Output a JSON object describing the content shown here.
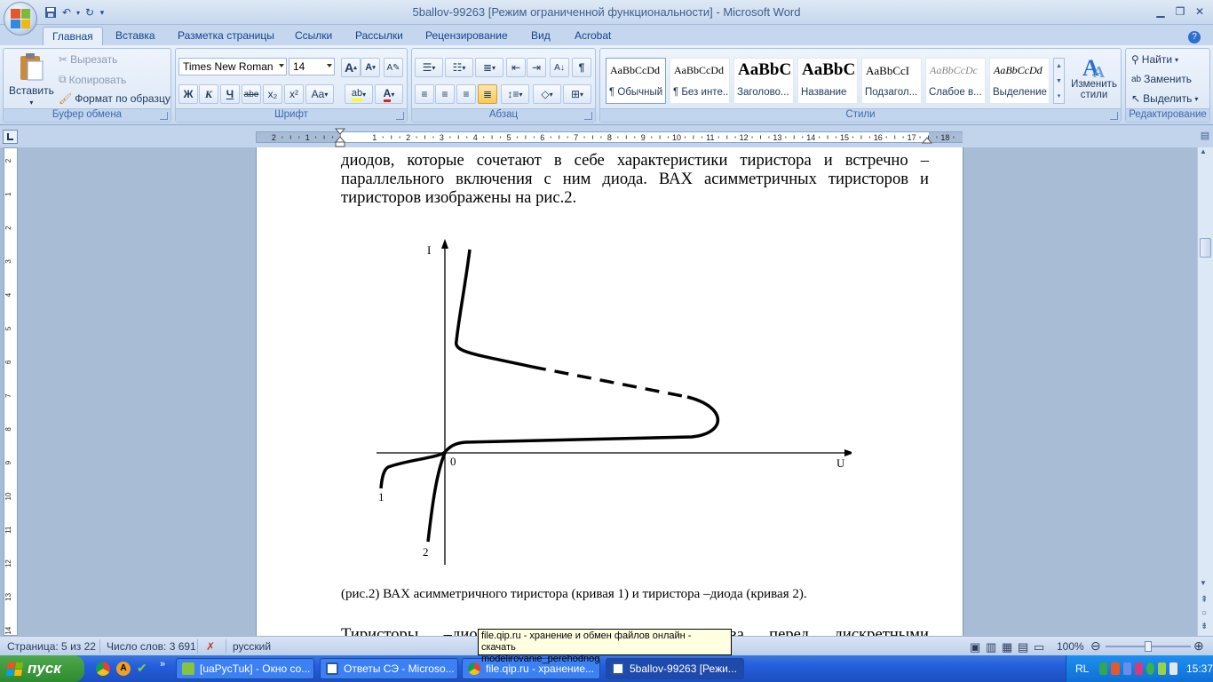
{
  "window": {
    "title": "5ballov-99263 [Режим ограниченной функциональности] - Microsoft Word"
  },
  "tabs": [
    "Главная",
    "Вставка",
    "Разметка страницы",
    "Ссылки",
    "Рассылки",
    "Рецензирование",
    "Вид",
    "Acrobat"
  ],
  "ribbon": {
    "clipboard": {
      "paste": "Вставить",
      "cut": "Вырезать",
      "copy": "Копировать",
      "format_painter": "Формат по образцу",
      "label": "Буфер обмена"
    },
    "font": {
      "font_name": "Times New Roman",
      "font_size": "14",
      "label": "Шрифт",
      "bold": "Ж",
      "italic": "К",
      "underline": "Ч",
      "strike": "abe",
      "subscript": "x₂",
      "superscript": "x²",
      "change_case": "Aa",
      "grow": "A",
      "shrink": "A",
      "highlight": "ab",
      "font_color": "A"
    },
    "paragraph": {
      "label": "Абзац",
      "pilcrow": "¶"
    },
    "styles": {
      "label": "Стили",
      "items": [
        {
          "sample": "AaBbCcDd",
          "name": "¶ Обычный"
        },
        {
          "sample": "AaBbCcDd",
          "name": "¶ Без инте..."
        },
        {
          "sample": "AaBbC",
          "name": "Заголово..."
        },
        {
          "sample": "AaBbC",
          "name": "Название"
        },
        {
          "sample": "AaBbCcI",
          "name": "Подзагол..."
        },
        {
          "sample": "AaBbCcDc",
          "name": "Слабое в..."
        },
        {
          "sample": "AaBbCcDd",
          "name": "Выделение"
        }
      ],
      "change_styles": "Изменить стили"
    },
    "editing": {
      "label": "Редактирование",
      "find": "Найти",
      "replace": "Заменить",
      "select": "Выделить"
    }
  },
  "ruler": {
    "labels": [
      "2",
      "1",
      "1",
      "2",
      "3",
      "4",
      "5",
      "6",
      "7",
      "8",
      "9",
      "10",
      "11",
      "12",
      "13",
      "14",
      "15",
      "16",
      "17",
      "18"
    ],
    "vlabels": [
      "2",
      "1",
      "2",
      "3",
      "4",
      "5",
      "6",
      "7",
      "8",
      "9",
      "10",
      "11",
      "12",
      "13",
      "14",
      "15",
      "16"
    ]
  },
  "document": {
    "line1": "диодов, которые сочетают в себе характеристики тиристора и встречно –",
    "line2": "параллельного включения с ним диода. ВАХ асимметричных тиристоров и",
    "line3": "тиристоров изображены на рис.2.",
    "figure": {
      "label_i": "I",
      "label_u": "U",
      "label_0": "0",
      "label_1": "1",
      "label_2": "2"
    },
    "caption": "(рис.2) ВАХ асимметричного тиристора (кривая 1) и тиристора –диода (кривая 2).",
    "next_line": "Тиристоры –диоды имеют ряд преимущества перед дискретными"
  },
  "statusbar": {
    "page": "Страница: 5 из 22",
    "words": "Число слов: 3 691",
    "language": "русский",
    "zoom": "100%",
    "zoom_level": 1.0
  },
  "tooltip": {
    "line1": "file.qip.ru - хранение и обмен файлов онлайн - скачать",
    "line2": "modelirovanie_perehodnog"
  },
  "taskbar": {
    "start": "пуск",
    "items": [
      {
        "label": "[uaPycTuk] - Окно со..."
      },
      {
        "label": "Ответы СЭ - Microso..."
      },
      {
        "label": "file.qip.ru - хранение..."
      },
      {
        "label": "5ballov-99263 [Режи..."
      }
    ],
    "lang": "RL",
    "clock": "15:37"
  },
  "colors": {
    "ribbon_text": "#15428b",
    "taskbar": "#245edb",
    "start": "#2f8b2f"
  }
}
